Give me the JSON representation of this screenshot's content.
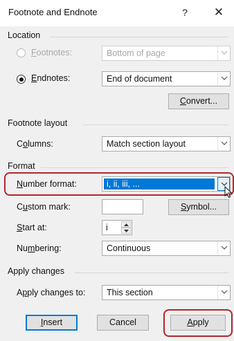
{
  "dialog": {
    "title": "Footnote and Endnote",
    "help_glyph": "?",
    "close_glyph": "✕"
  },
  "location": {
    "header": "Location",
    "footnotes_label": "Footnotes:",
    "footnotes_value": "Bottom of page",
    "endnotes_label": "Endnotes:",
    "endnotes_value": "End of document",
    "selected": "endnotes",
    "convert_label": "Convert..."
  },
  "footnote_layout": {
    "header": "Footnote layout",
    "columns_label": "Columns:",
    "columns_value": "Match section layout"
  },
  "format": {
    "header": "Format",
    "number_format_label": "Number format:",
    "number_format_value": "i, ii, iii, ...",
    "custom_mark_label": "Custom mark:",
    "custom_mark_value": "",
    "symbol_label": "Symbol...",
    "start_at_label": "Start at:",
    "start_at_value": "i",
    "numbering_label": "Numbering:",
    "numbering_value": "Continuous"
  },
  "apply_changes": {
    "header": "Apply changes",
    "apply_to_label": "Apply changes to:",
    "apply_to_value": "This section"
  },
  "buttons": {
    "insert": "Insert",
    "cancel": "Cancel",
    "apply": "Apply"
  },
  "colors": {
    "highlight": "#0078d7",
    "callout": "#b3262a",
    "body_bg": "#f0f0f0"
  }
}
